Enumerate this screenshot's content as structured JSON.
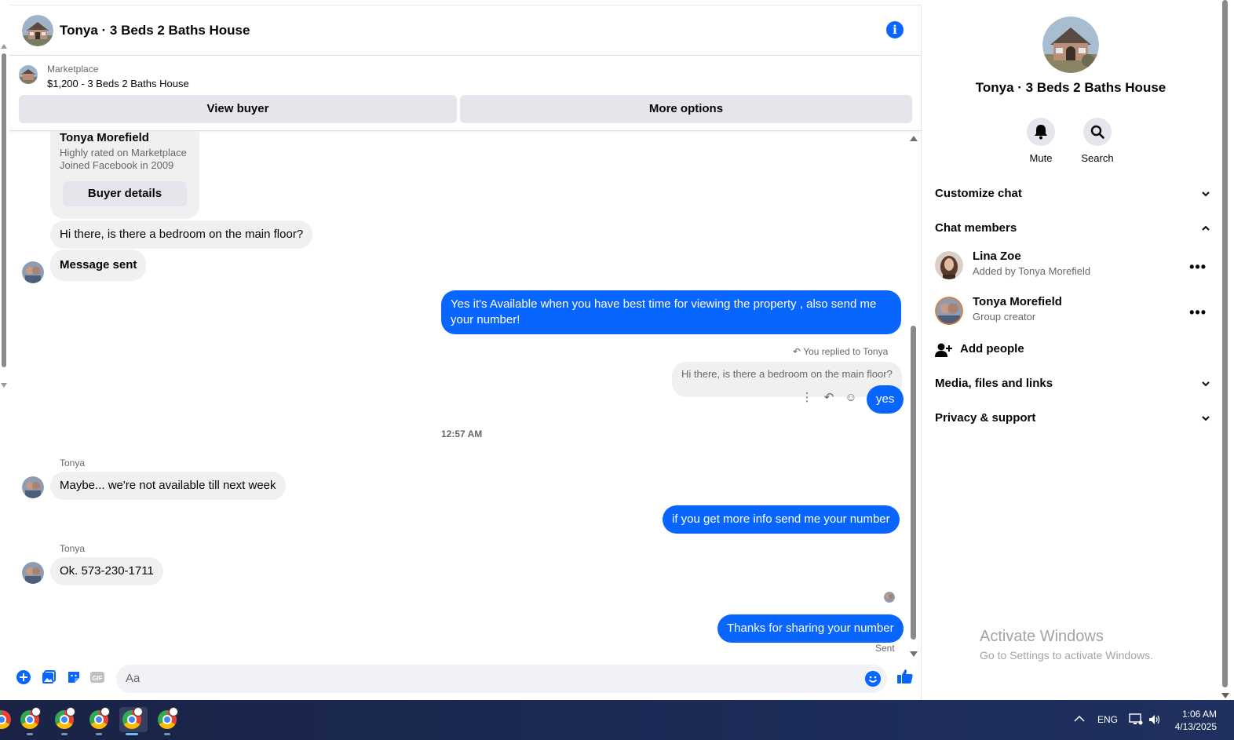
{
  "chat": {
    "title": "Tonya · 3 Beds 2 Baths House",
    "listing": {
      "source": "Marketplace",
      "price_title": "$1,200 - 3 Beds 2 Baths House",
      "view_buyer": "View buyer",
      "more_options": "More options"
    },
    "buyer_card": {
      "name": "Tonya Morefield",
      "line1": "Highly rated on Marketplace",
      "line2": "Joined Facebook in 2009",
      "button": "Buyer details"
    },
    "messages": {
      "m1": "Hi there, is there a bedroom on the main floor?",
      "m2": "Message sent",
      "m3": "Yes it's Available when you have best time for viewing the property , also send me your number!",
      "replied_label": "You replied to Tonya",
      "quoted": "Hi there, is there a bedroom on the main floor?",
      "m4": "yes",
      "timestamp": "12:57 AM",
      "sender1": "Tonya",
      "m5": "Maybe... we're not available till next week",
      "m6": "if you get more info send me your number",
      "sender2": "Tonya",
      "m7": "Ok. 573-230-1711",
      "m8": "Thanks for sharing your number",
      "status": "Sent"
    },
    "composer": {
      "placeholder": "Aa"
    }
  },
  "details": {
    "title": "Tonya · 3 Beds 2 Baths House",
    "mute": "Mute",
    "search": "Search",
    "customize": "Customize chat",
    "members_header": "Chat members",
    "members": [
      {
        "name": "Lina Zoe",
        "sub": "Added by Tonya Morefield"
      },
      {
        "name": "Tonya Morefield",
        "sub": "Group creator"
      }
    ],
    "add_people": "Add people",
    "media": "Media, files and links",
    "privacy": "Privacy & support"
  },
  "watermark": {
    "line1": "Activate Windows",
    "line2": "Go to Settings to activate Windows."
  },
  "taskbar": {
    "lang": "ENG",
    "time": "1:06 AM",
    "date": "4/13/2025"
  },
  "colors": {
    "accent": "#0866ff",
    "bubble_in": "#f0f0f0",
    "secondary_text": "#65676b"
  }
}
